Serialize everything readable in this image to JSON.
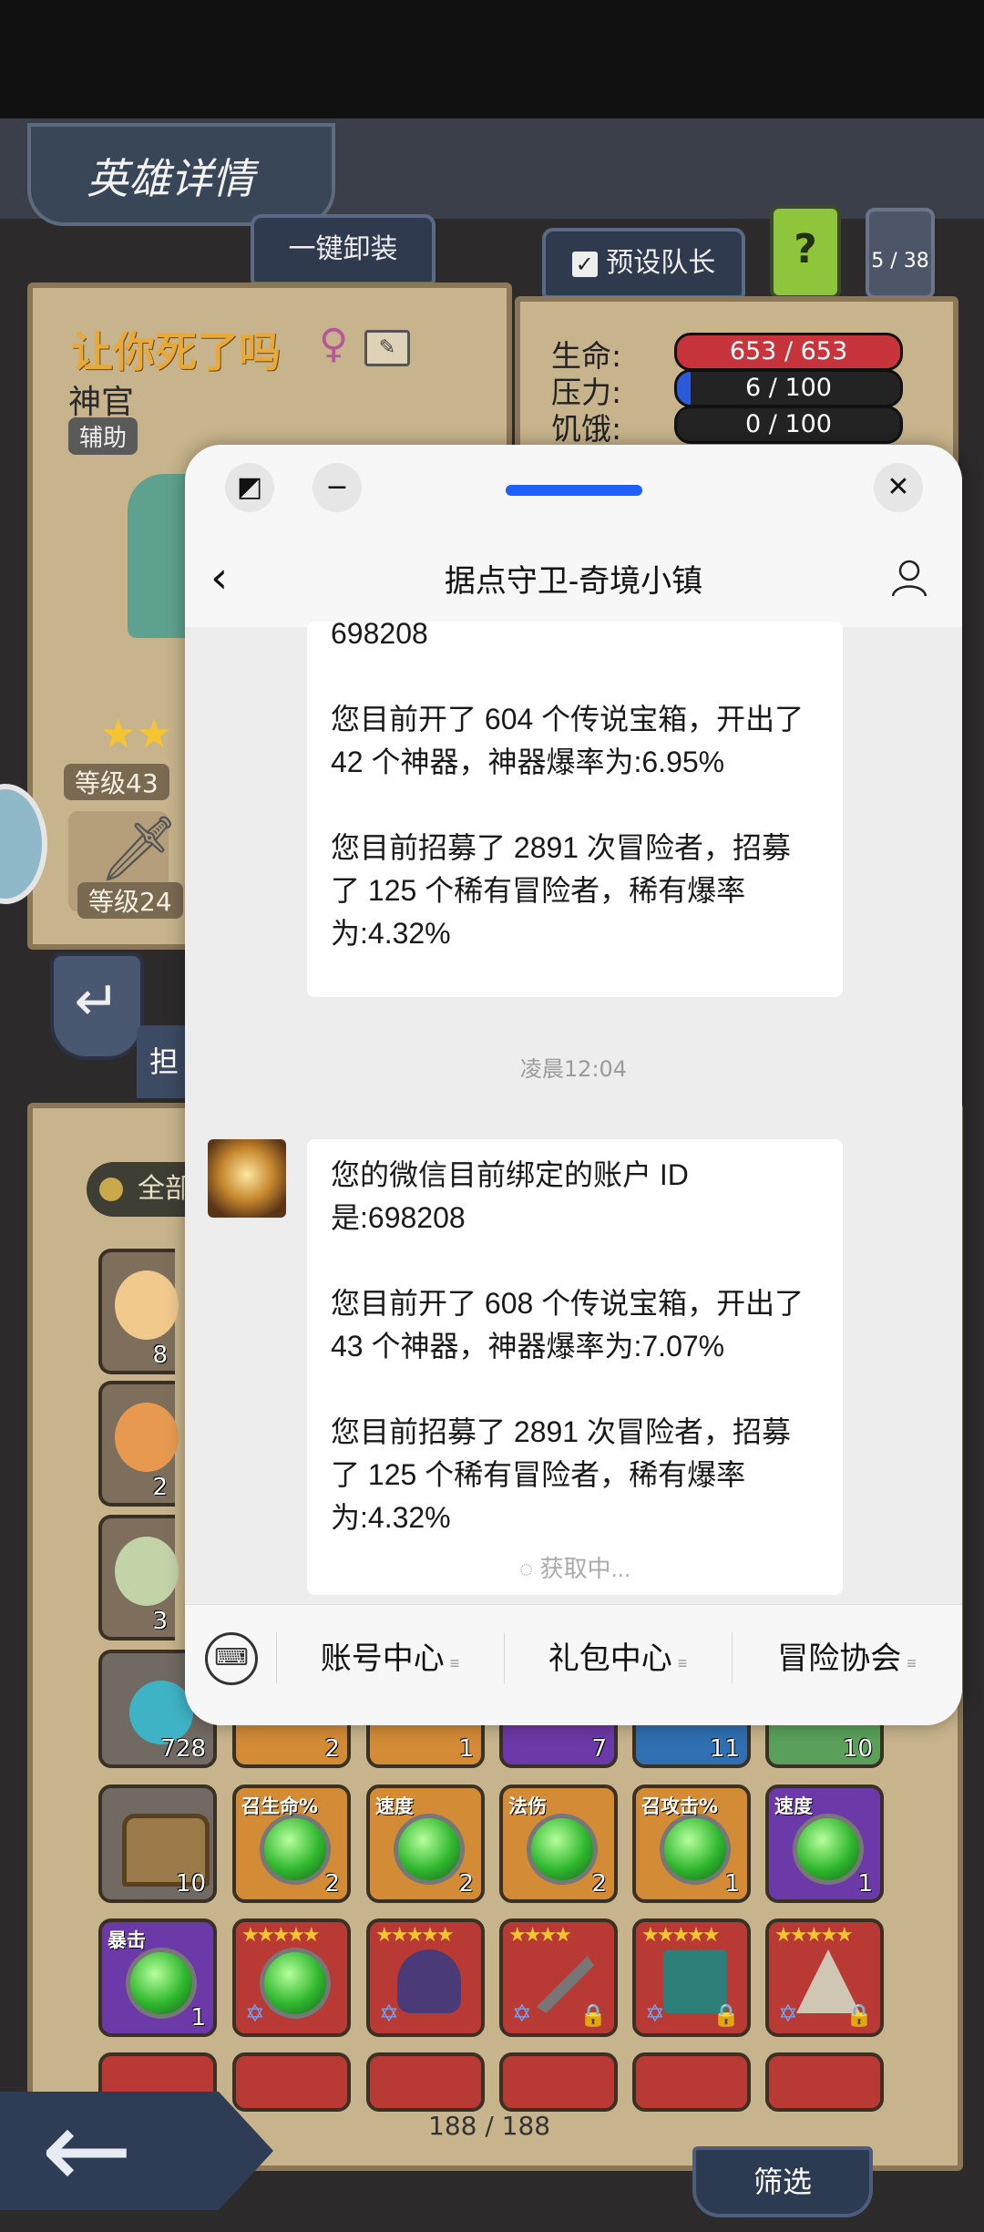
{
  "game": {
    "title": "英雄详情",
    "unequip_all": "一键卸装",
    "preset_leader": "预设队长",
    "help": "?",
    "count_badge": "5 / 38",
    "hero": {
      "name": "让你死了吗",
      "class": "神官",
      "role": "辅助",
      "level": "等级43",
      "weapon_level": "等级24"
    },
    "stats": {
      "hp_label": "生命:",
      "hp_value": "653 / 653",
      "hp_fraction": 1.0,
      "stress_label": "压力:",
      "stress_value": "6 / 100",
      "stress_fraction": 0.06,
      "hunger_label": "饥饿:",
      "hunger_value": "0 / 100",
      "hunger_fraction": 0.0
    },
    "filter_all": "全部",
    "partial_tab": "担",
    "inventory": {
      "row1": [
        {
          "count": "728"
        },
        {
          "count": "2"
        },
        {
          "count": "1"
        },
        {
          "count": "7"
        },
        {
          "count": "11"
        },
        {
          "count": "10"
        }
      ],
      "row2": [
        {
          "label": "",
          "count": "10"
        },
        {
          "label": "召生命%",
          "count": "2"
        },
        {
          "label": "速度",
          "count": "2"
        },
        {
          "label": "法伤",
          "count": "2"
        },
        {
          "label": "召攻击%",
          "count": "1"
        },
        {
          "label": "速度",
          "count": "1"
        }
      ],
      "row3": [
        {
          "label": "暴击",
          "count": "1"
        },
        {
          "stars": "★★★★★"
        },
        {
          "stars": "★★★★★"
        },
        {
          "stars": "★★★★"
        },
        {
          "stars": "★★★★★"
        },
        {
          "stars": "★★★★★"
        }
      ],
      "partial_counts": [
        "8",
        "2",
        "3"
      ]
    },
    "page_count": "188 / 188",
    "filter_button": "筛选",
    "lock_icon": "lock-icon",
    "star_of_david_icon": "✡"
  },
  "panel": {
    "title": "据点守卫-奇境小镇",
    "chat": {
      "msg1": {
        "line_top": "698208",
        "p1": "您目前开了 604 个传说宝箱，开出了 42 个神器，神器爆率为:6.95%",
        "p2": "您目前招募了 2891 次冒险者，招募了 125 个稀有冒险者，稀有爆率为:4.32%"
      },
      "timestamp": "凌晨12:04",
      "msg2": {
        "p0": "您的微信目前绑定的账户 ID 是:698208",
        "p1": "您目前开了 608 个传说宝箱，开出了 43 个神器，神器爆率为:7.07%",
        "p2": "您目前招募了 2891 次冒险者，招募了 125 个稀有冒险者，稀有爆率为:4.32%",
        "loading": "获取中..."
      }
    },
    "menu": {
      "item1": "账号中心",
      "item2": "礼包中心",
      "item3": "冒险协会"
    },
    "colors": {
      "accent": "#1f5fff"
    }
  }
}
